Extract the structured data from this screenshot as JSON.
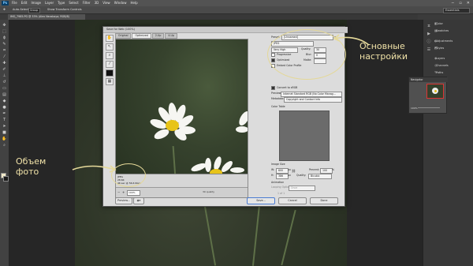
{
  "app": {
    "logo": "Ps",
    "menu": [
      "File",
      "Edit",
      "Image",
      "Layer",
      "Type",
      "Select",
      "Filter",
      "3D",
      "View",
      "Window",
      "Help"
    ],
    "window_controls": [
      "−",
      "▫",
      "✕"
    ]
  },
  "options_bar": {
    "auto_select_label": "Auto-Select:",
    "auto_select_value": "Group",
    "show_transform": "Show Transform Controls",
    "workspace": "Essentials"
  },
  "document_tab": {
    "label": "IMG_7985.PG @ 33% (Alex Nevskaya; RGB/8)"
  },
  "dialog": {
    "title": "Save for Web (100%)",
    "view_tabs": [
      "Original",
      "Optimized",
      "2-Up",
      "4-Up"
    ],
    "selected_tab": "Optimized",
    "preview_info": [
      "JPEG",
      "28.6K",
      "46 sec @ 56.6 Kbps"
    ],
    "zoom": "100%",
    "status_quality": "30 quality",
    "preset_label": "Preset:",
    "preset_value": "[Unnamed]",
    "format_value": "JPEG",
    "quality_preset": "Very High",
    "quality_label": "Quality:",
    "quality_value": "30",
    "progressive_label": "Progressive",
    "blur_label": "Blur:",
    "blur_value": "0",
    "optimized_label": "Optimized",
    "matte_label": "Matte:",
    "embed_profile_label": "Embed Color Profile",
    "convert_srgb_label": "Convert to sRGB",
    "preview_label": "Preview:",
    "preview_value": "Internet Standard RGB (No Color Manag...",
    "metadata_label": "Metadata:",
    "metadata_value": "Copyright and Contact Info",
    "color_table_label": "Color Table",
    "image_size_label": "Image Size",
    "w_label": "W:",
    "w_value": "600",
    "h_label": "H:",
    "h_value": "386",
    "px": "px",
    "percent_label": "Percent:",
    "percent_value": "100",
    "pct": "%",
    "quality2_label": "Quality:",
    "quality2_value": "Bicubic",
    "animation_label": "Animation",
    "looping_label": "Looping Options:",
    "looping_value": "Once",
    "frame_counter": "1 of 1",
    "buttons": {
      "preview": "Preview...",
      "save": "Save...",
      "cancel": "Cancel",
      "done": "Done"
    }
  },
  "right_panel": {
    "items": [
      "Color",
      "Swatches",
      "Adjustments",
      "Styles",
      "Layers",
      "Channels",
      "Paths"
    ],
    "navigator_title": "Navigator",
    "navigator_zoom": "100%"
  },
  "annotations": {
    "settings_label": [
      "Основные",
      "настройки"
    ],
    "size_label": [
      "Объем",
      "фото"
    ]
  },
  "colors": {
    "annotation": "#f0e2a8",
    "ps_bg": "#3b3b3b",
    "dialog_bg": "#dcdcdc"
  }
}
